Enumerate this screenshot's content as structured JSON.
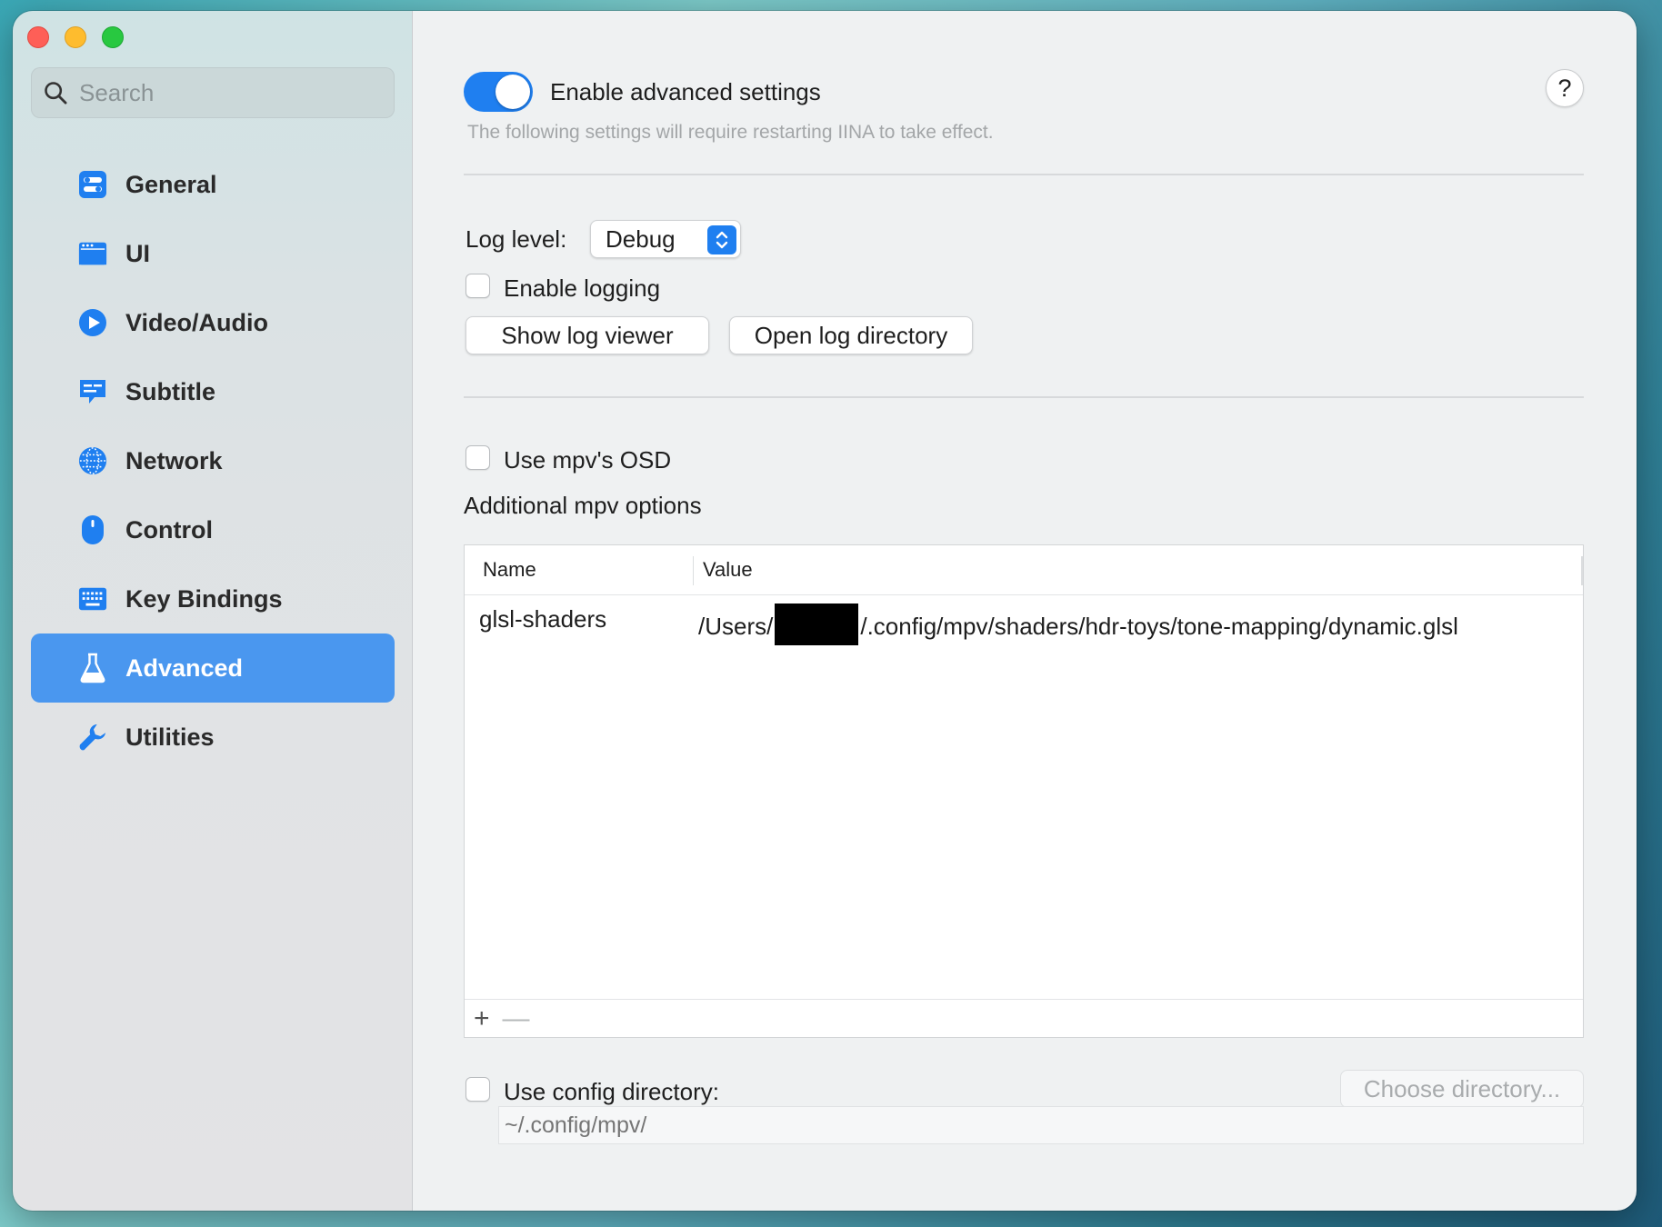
{
  "sidebar": {
    "search_placeholder": "Search",
    "items": [
      {
        "label": "General",
        "icon": "toggles-icon"
      },
      {
        "label": "UI",
        "icon": "window-icon"
      },
      {
        "label": "Video/Audio",
        "icon": "play-circle-icon"
      },
      {
        "label": "Subtitle",
        "icon": "speech-bubble-icon"
      },
      {
        "label": "Network",
        "icon": "globe-icon"
      },
      {
        "label": "Control",
        "icon": "mouse-icon"
      },
      {
        "label": "Key Bindings",
        "icon": "keyboard-icon"
      },
      {
        "label": "Advanced",
        "icon": "flask-icon",
        "active": true
      },
      {
        "label": "Utilities",
        "icon": "wrench-icon"
      }
    ]
  },
  "main": {
    "enable_advanced": {
      "label": "Enable advanced settings",
      "on": true
    },
    "restart_note": "The following settings will require restarting IINA to take effect.",
    "help_label": "?",
    "log_level": {
      "label": "Log level:",
      "value": "Debug"
    },
    "enable_logging": "Enable logging",
    "show_log_viewer": "Show log viewer",
    "open_log_directory": "Open log directory",
    "use_mpv_osd": "Use mpv's OSD",
    "additional_mpv_options": "Additional mpv options",
    "table": {
      "columns": [
        "Name",
        "Value"
      ],
      "rows": [
        {
          "name": "glsl-shaders",
          "value_prefix": "/Users/",
          "value_suffix": "/.config/mpv/shaders/hdr-toys/tone-mapping/dynamic.glsl"
        }
      ],
      "add": "+",
      "remove": "—"
    },
    "use_config_directory": "Use config directory:",
    "choose_directory": "Choose directory...",
    "config_path_placeholder": "~/.config/mpv/"
  },
  "colors": {
    "accent": "#1f7ff0",
    "sidebar_active": "#4a97ef"
  }
}
